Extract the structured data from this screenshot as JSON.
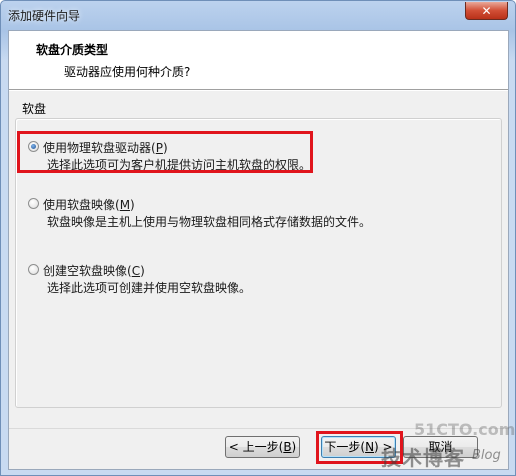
{
  "window": {
    "title": "添加硬件向导",
    "close_label": "✕"
  },
  "header": {
    "title": "软盘介质类型",
    "subtitle": "驱动器应使用何种介质?"
  },
  "group": {
    "label": "软盘"
  },
  "options": [
    {
      "label_prefix": "使用物理软盘驱动器(",
      "accel": "P",
      "label_suffix": ")",
      "description": "选择此选项可为客户机提供访问主机软盘的权限。",
      "selected": true
    },
    {
      "label_prefix": "使用软盘映像(",
      "accel": "M",
      "label_suffix": ")",
      "description": "软盘映像是主机上使用与物理软盘相同格式存储数据的文件。",
      "selected": false
    },
    {
      "label_prefix": "创建空软盘映像(",
      "accel": "C",
      "label_suffix": ")",
      "description": "选择此选项可创建并使用空软盘映像。",
      "selected": false
    }
  ],
  "buttons": {
    "back_prefix": "< 上一步(",
    "back_accel": "B",
    "back_suffix": ")",
    "next_prefix": "下一步(",
    "next_accel": "N",
    "next_suffix": ") >",
    "cancel": "取消"
  },
  "watermark": {
    "text": "技术博客",
    "suffix": "Blog",
    "logo": "51CTO.com"
  },
  "colors": {
    "highlight": "#e0141c",
    "title_bar": "#bcd2ee"
  }
}
